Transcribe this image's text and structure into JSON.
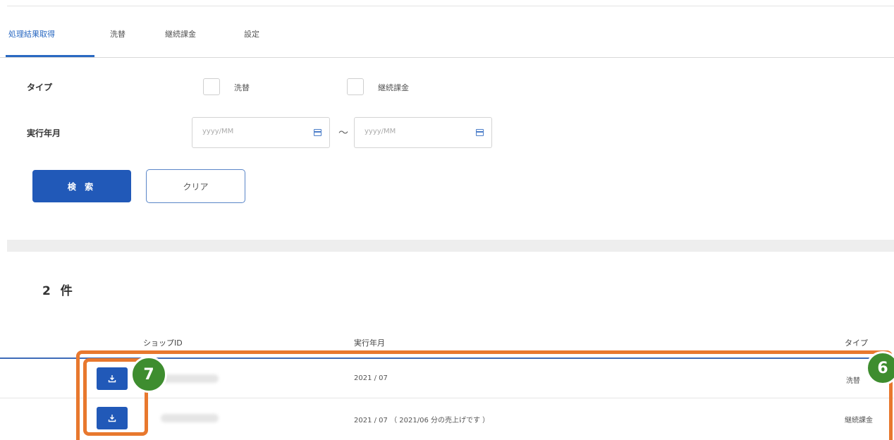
{
  "tabs": [
    {
      "label": "処理結果取得",
      "active": true
    },
    {
      "label": "洗替",
      "active": false
    },
    {
      "label": "継続課金",
      "active": false
    },
    {
      "label": "設定",
      "active": false
    }
  ],
  "form": {
    "type_label": "タイプ",
    "type_options": [
      "洗替",
      "継続課金"
    ],
    "date_label": "実行年月",
    "date_from_placeholder": "yyyy/MM",
    "date_to_placeholder": "yyyy/MM",
    "range_separator": "～",
    "search_button": "検 索",
    "clear_button": "クリア"
  },
  "results": {
    "count_text": "2 件",
    "columns": [
      "ショップID",
      "実行年月",
      "タイプ"
    ],
    "rows": [
      {
        "run_month": "2021 / 07",
        "type": "洗替"
      },
      {
        "run_month": "2021 / 07 （ 2021/06 分の売上げです ）",
        "type": "継続課金"
      }
    ]
  },
  "annotations": {
    "badge_row_box": "6",
    "badge_download": "7",
    "highlight_color": "#e8782e",
    "badge_color": "#3e8d2f"
  },
  "colors": {
    "primary": "#2159b8",
    "active_tab": "#2a69c2"
  }
}
